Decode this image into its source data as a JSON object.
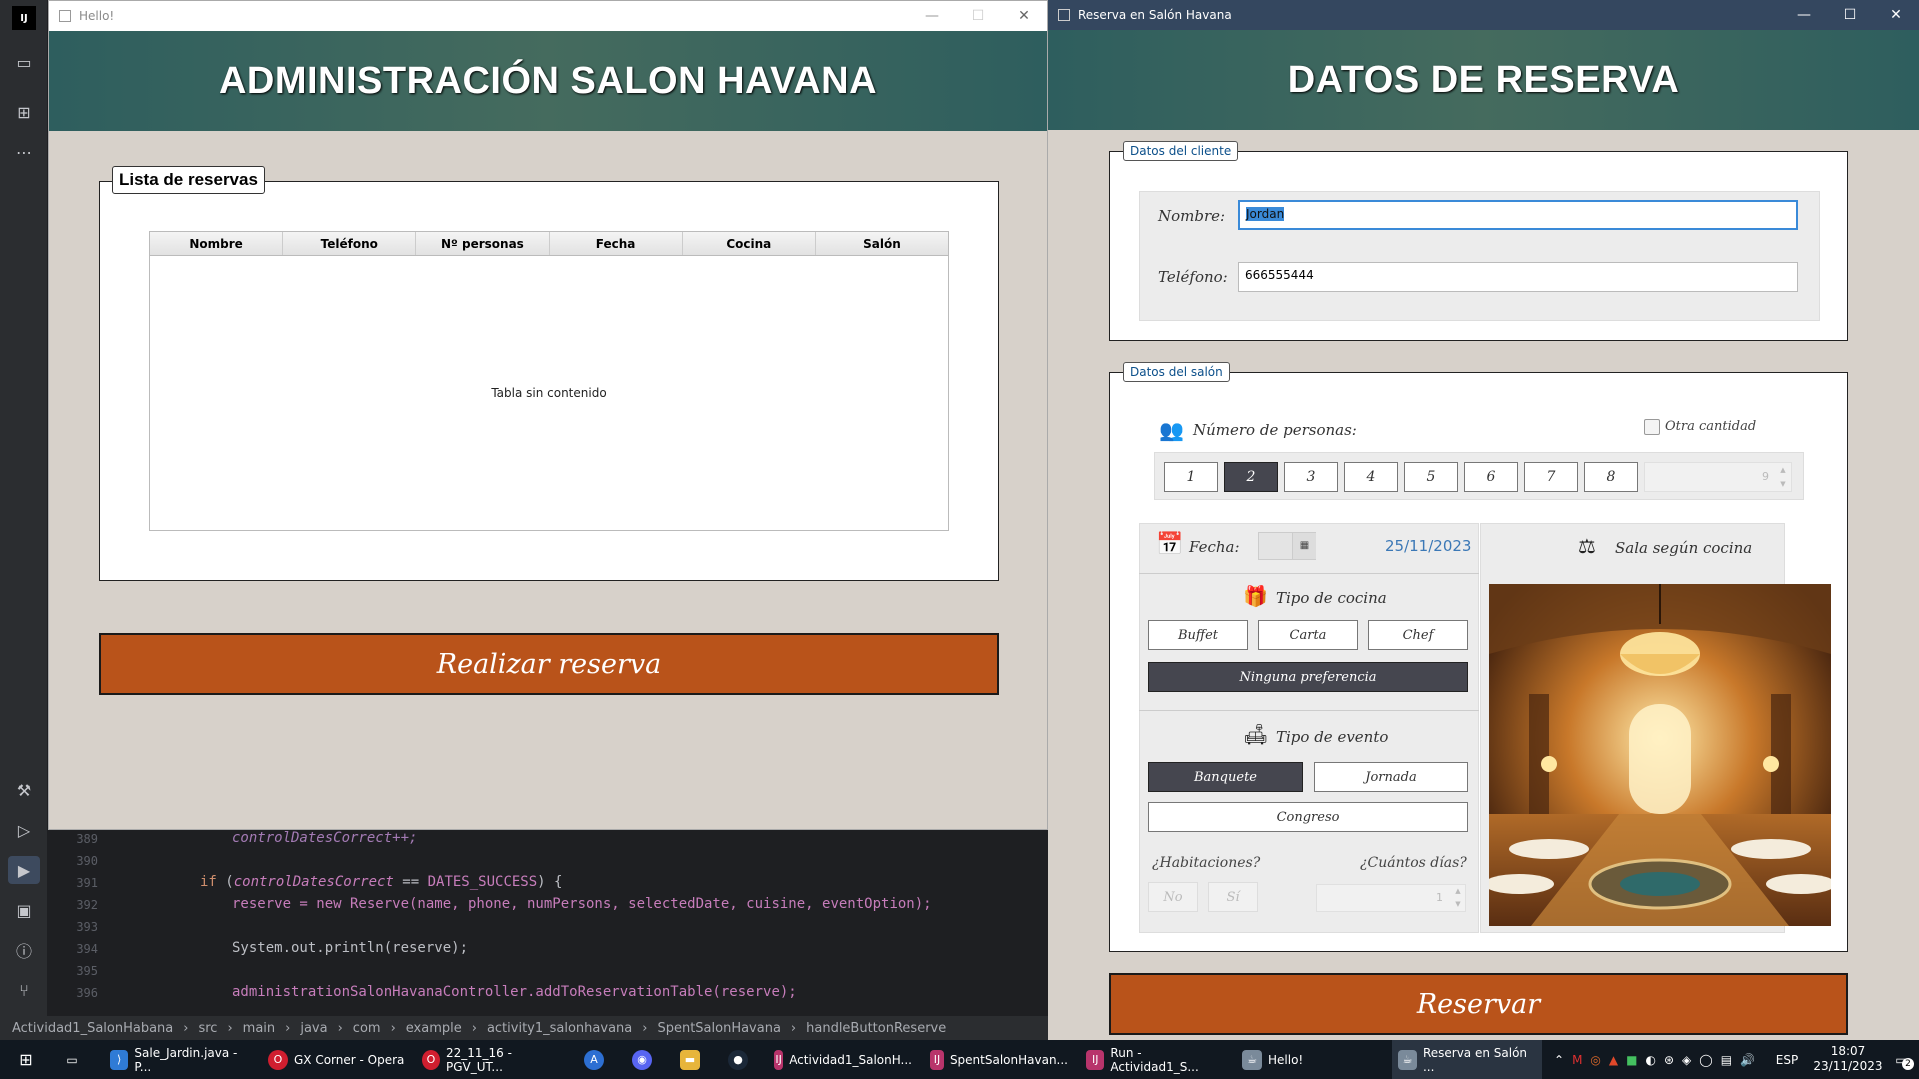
{
  "admin_window": {
    "title": "Hello!",
    "header": "ADMINISTRACIÓN SALON HAVANA",
    "group_title": "Lista de reservas",
    "table": {
      "columns": [
        "Nombre",
        "Teléfono",
        "Nº personas",
        "Fecha",
        "Cocina",
        "Salón"
      ],
      "empty_text": "Tabla sin contenido"
    },
    "reserve_button": "Realizar reserva"
  },
  "reserve_window": {
    "title": "Reserva en Salón Havana",
    "header": "DATOS DE RESERVA",
    "client_section": {
      "legend": "Datos del cliente",
      "name_label": "Nombre:",
      "name_value": "Jordan",
      "phone_label": "Teléfono:",
      "phone_value": "666555444"
    },
    "salon_section": {
      "legend": "Datos del salón",
      "persons_label": "Número de personas:",
      "other_amount_label": "Otra cantidad",
      "persons_options": [
        "1",
        "2",
        "3",
        "4",
        "5",
        "6",
        "7",
        "8"
      ],
      "persons_selected": "2",
      "persons_spinner_value": "9",
      "date_label": "Fecha:",
      "date_value": "25/11/2023",
      "cuisine_title": "Tipo de cocina",
      "cuisine_options": [
        "Buffet",
        "Carta",
        "Chef"
      ],
      "no_preference": "Ninguna preferencia",
      "event_title": "Tipo de evento",
      "event_banquet": "Banquete",
      "event_jornada": "Jornada",
      "event_congreso": "Congreso",
      "rooms_label": "¿Habitaciones?",
      "days_label": "¿Cuántos días?",
      "rooms_no": "No",
      "rooms_yes": "Sí",
      "days_value": "1",
      "sala_title": "Sala según cocina"
    },
    "reserve_button": "Reservar"
  },
  "ide": {
    "line_numbers": [
      "389",
      "390",
      "391",
      "392",
      "393",
      "394",
      "395",
      "396"
    ],
    "code_389": "controlDatesCorrect++;",
    "code_391a": "if",
    "code_391b": " (",
    "code_391c": "controlDatesCorrect",
    "code_391d": " == ",
    "code_391e": "DATES_SUCCESS",
    "code_391f": ") {",
    "code_392": "reserve = new Reserve(name, phone, numPersons, selectedDate, cuisine, eventOption);",
    "code_394": "System.out.println(reserve);",
    "code_396": "administrationSalonHavanaController.addToReservationTable(reserve);",
    "breadcrumb": [
      "Actividad1_SalonHabana",
      "src",
      "main",
      "java",
      "com",
      "example",
      "activity1_salonhavana",
      "SpentSalonHavana",
      "handleButtonReserve"
    ]
  },
  "taskbar": {
    "items": [
      {
        "label": "Sale_Jardin.java - P...",
        "color": "#2f7bd6"
      },
      {
        "label": "GX Corner - Opera",
        "color": "#d01e2f"
      },
      {
        "label": "22_11_16 - PGV_UT...",
        "color": "#d01e2f"
      },
      {
        "label": "Actividad1_SalonH...",
        "color": "#b8346b"
      },
      {
        "label": "SpentSalonHavan...",
        "color": "#b8346b"
      },
      {
        "label": "Run - Actividad1_S...",
        "color": "#b8346b"
      },
      {
        "label": "Hello!",
        "color": "#7a8a9a"
      },
      {
        "label": "Reserva en Salón ...",
        "color": "#7a8a9a"
      }
    ],
    "language": "ESP",
    "time": "18:07",
    "date": "23/11/2023",
    "notifications": "2"
  }
}
